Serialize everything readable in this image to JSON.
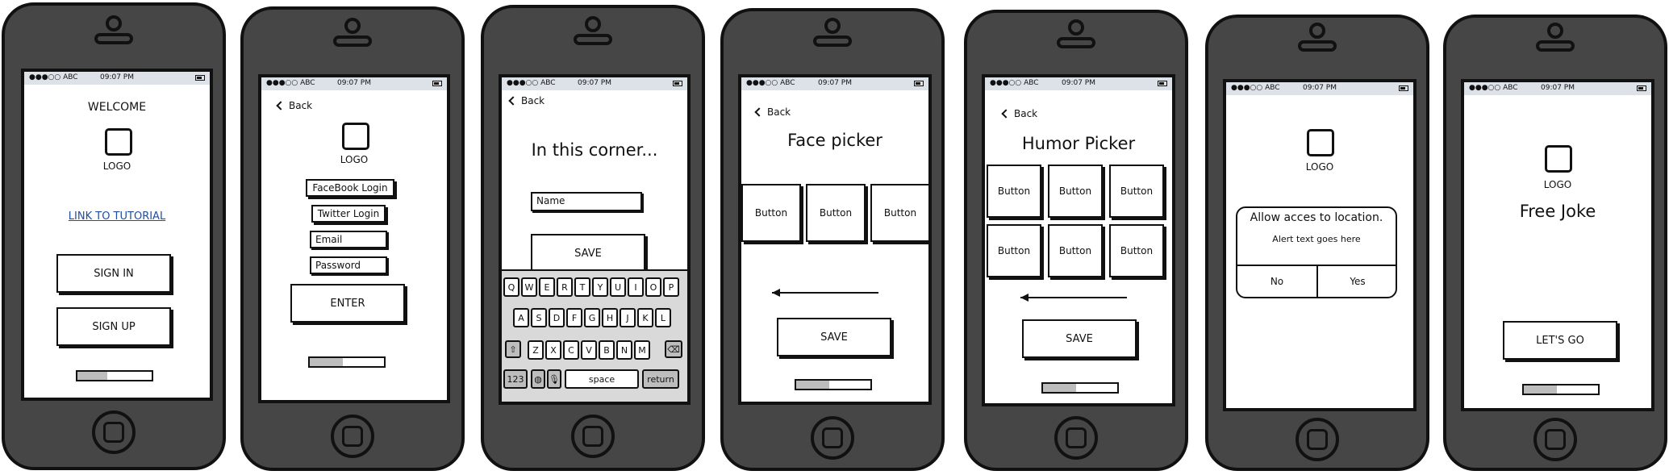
{
  "status": {
    "carrier": "●●●○○ ABC",
    "time": "09:07 PM"
  },
  "screens": {
    "welcome": {
      "title": "WELCOME",
      "logo": "LOGO",
      "tutorial_link": "LINK TO TUTORIAL",
      "sign_in": "SIGN IN",
      "sign_up": "SIGN UP",
      "progress": 0.4
    },
    "login": {
      "back": "Back",
      "logo": "LOGO",
      "facebook": "FaceBook Login",
      "twitter": "Twitter Login",
      "email_placeholder": "Email",
      "password_placeholder": "Password",
      "enter": "ENTER",
      "progress": 0.45
    },
    "corner": {
      "back": "Back",
      "title": "In this corner...",
      "name_placeholder": "Name",
      "save": "SAVE",
      "keyboard": {
        "row1": [
          "Q",
          "W",
          "E",
          "R",
          "T",
          "Y",
          "U",
          "I",
          "O",
          "P"
        ],
        "row2": [
          "A",
          "S",
          "D",
          "F",
          "G",
          "H",
          "J",
          "K",
          "L"
        ],
        "row3": [
          "Z",
          "X",
          "C",
          "V",
          "B",
          "N",
          "M"
        ],
        "numbers": "123",
        "space": "space",
        "return": "return"
      }
    },
    "face_picker": {
      "back": "Back",
      "title": "Face picker",
      "buttons": [
        "Button",
        "Button",
        "Button"
      ],
      "save": "SAVE",
      "progress": 0.45
    },
    "humor_picker": {
      "back": "Back",
      "title": "Humor Picker",
      "buttons": [
        "Button",
        "Button",
        "Button",
        "Button",
        "Button",
        "Button"
      ],
      "save": "SAVE",
      "progress": 0.45
    },
    "location_alert": {
      "logo": "LOGO",
      "alert_title": "Allow acces to location.",
      "alert_text": "Alert text goes here",
      "no": "No",
      "yes": "Yes"
    },
    "free_joke": {
      "logo": "LOGO",
      "title": "Free Joke",
      "lets_go": "LET'S GO",
      "progress": 0.45
    }
  }
}
